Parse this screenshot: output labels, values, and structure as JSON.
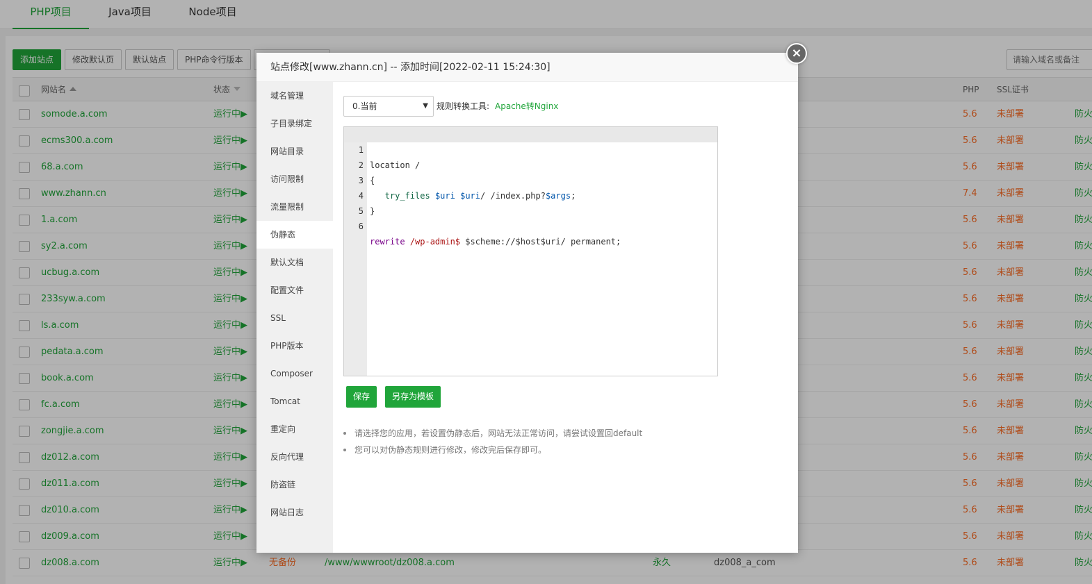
{
  "top_tabs": [
    "PHP项目",
    "Java项目",
    "Node项目"
  ],
  "toolbar": {
    "add_site": "添加站点",
    "modify_default_page": "修改默认页",
    "default_site": "默认站点",
    "php_cli_version": "PHP命令行版本"
  },
  "search": {
    "placeholder": "请输入域名或备注"
  },
  "table": {
    "columns": {
      "name": "网站名",
      "status": "状态",
      "php": "PHP",
      "ssl": "SSL证书"
    },
    "rows": [
      {
        "name": "somode.a.com",
        "status": "运行中▶",
        "php": "5.6",
        "ssl": "未部署",
        "fw": "防火"
      },
      {
        "name": "ecms300.a.com",
        "status": "运行中▶",
        "php": "5.6",
        "ssl": "未部署",
        "fw": "防火"
      },
      {
        "name": "68.a.com",
        "status": "运行中▶",
        "php": "5.6",
        "ssl": "未部署",
        "fw": "防火"
      },
      {
        "name": "www.zhann.cn",
        "status": "运行中▶",
        "php": "7.4",
        "ssl": "未部署",
        "fw": "防火"
      },
      {
        "name": "1.a.com",
        "status": "运行中▶",
        "php": "5.6",
        "ssl": "未部署",
        "fw": "防火"
      },
      {
        "name": "sy2.a.com",
        "status": "运行中▶",
        "php": "5.6",
        "ssl": "未部署",
        "fw": "防火"
      },
      {
        "name": "ucbug.a.com",
        "status": "运行中▶",
        "php": "5.6",
        "ssl": "未部署",
        "fw": "防火"
      },
      {
        "name": "233syw.a.com",
        "status": "运行中▶",
        "php": "5.6",
        "ssl": "未部署",
        "fw": "防火"
      },
      {
        "name": "ls.a.com",
        "status": "运行中▶",
        "php": "5.6",
        "ssl": "未部署",
        "fw": "防火"
      },
      {
        "name": "pedata.a.com",
        "status": "运行中▶",
        "php": "5.6",
        "ssl": "未部署",
        "fw": "防火"
      },
      {
        "name": "book.a.com",
        "status": "运行中▶",
        "php": "5.6",
        "ssl": "未部署",
        "fw": "防火"
      },
      {
        "name": "fc.a.com",
        "status": "运行中▶",
        "php": "5.6",
        "ssl": "未部署",
        "fw": "防火"
      },
      {
        "name": "zongjie.a.com",
        "status": "运行中▶",
        "php": "5.6",
        "ssl": "未部署",
        "fw": "防火"
      },
      {
        "name": "dz012.a.com",
        "status": "运行中▶",
        "php": "5.6",
        "ssl": "未部署",
        "fw": "防火"
      },
      {
        "name": "dz011.a.com",
        "status": "运行中▶",
        "php": "5.6",
        "ssl": "未部署",
        "fw": "防火"
      },
      {
        "name": "dz010.a.com",
        "status": "运行中▶",
        "php": "5.6",
        "ssl": "未部署",
        "fw": "防火"
      },
      {
        "name": "dz009.a.com",
        "status": "运行中▶",
        "php": "5.6",
        "ssl": "未部署",
        "fw": "防火"
      },
      {
        "name": "dz008.a.com",
        "status": "运行中▶",
        "backup": "无备份",
        "path": "/www/wwwroot/dz008.a.com",
        "expire": "永久",
        "remark": "dz008_a_com",
        "php": "5.6",
        "ssl": "未部署",
        "fw": "防火"
      }
    ]
  },
  "modal": {
    "title": "站点修改[www.zhann.cn] -- 添加时间[2022-02-11 15:24:30]",
    "close_icon": "close-icon",
    "menu": [
      "域名管理",
      "子目录绑定",
      "网站目录",
      "访问限制",
      "流量限制",
      "伪静态",
      "默认文档",
      "配置文件",
      "SSL",
      "PHP版本",
      "Composer",
      "Tomcat",
      "重定向",
      "反向代理",
      "防盗链",
      "网站日志"
    ],
    "active_menu": "伪静态",
    "rewrite_select": "0.当前",
    "tool_label": "规则转换工具:",
    "tool_link": "Apache转Nginx",
    "code_line_numbers": [
      "1",
      "2",
      "3",
      "4",
      "5",
      "6"
    ],
    "code": {
      "l1": "location /",
      "l2": "{",
      "l3_fn": "try_files",
      "l3_v1": "$uri",
      "l3_v2": "$uri",
      "l3_s1": "/",
      "l3_s2": "/index.php?",
      "l3_v3": "$args",
      "l3_end": ";",
      "l4": "}",
      "l6_kw": "rewrite",
      "l6_re": "/wp-admin$",
      "l6_rest": "$scheme://$host$uri/ permanent;"
    },
    "save_label": "保存",
    "save_template_label": "另存为模板",
    "tips": [
      "请选择您的应用，若设置伪静态后，网站无法正常访问，请尝试设置回default",
      "您可以对伪静态规则进行修改，修改完后保存即可。"
    ]
  }
}
